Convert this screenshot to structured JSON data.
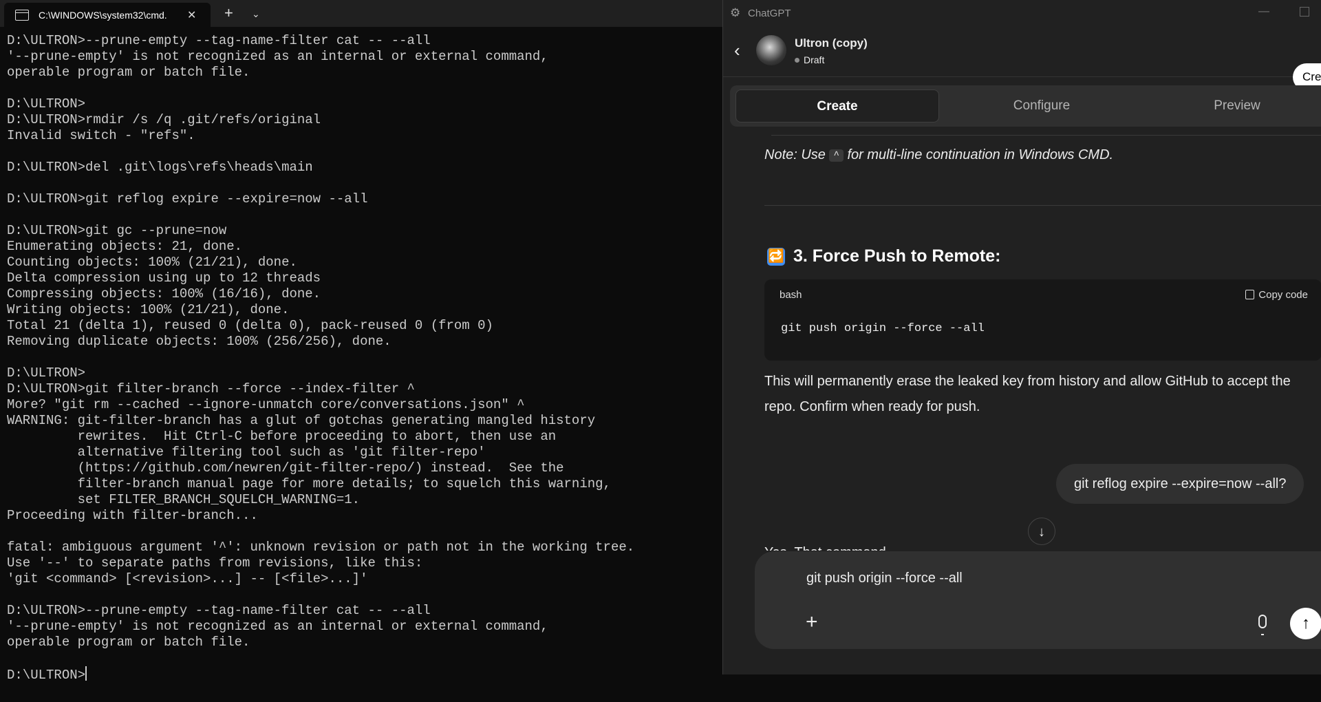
{
  "terminal": {
    "tab_title": "C:\\WINDOWS\\system32\\cmd.",
    "output": "D:\\ULTRON>--prune-empty --tag-name-filter cat -- --all\n'--prune-empty' is not recognized as an internal or external command,\noperable program or batch file.\n\nD:\\ULTRON>\nD:\\ULTRON>rmdir /s /q .git/refs/original\nInvalid switch - \"refs\".\n\nD:\\ULTRON>del .git\\logs\\refs\\heads\\main\n\nD:\\ULTRON>git reflog expire --expire=now --all\n\nD:\\ULTRON>git gc --prune=now\nEnumerating objects: 21, done.\nCounting objects: 100% (21/21), done.\nDelta compression using up to 12 threads\nCompressing objects: 100% (16/16), done.\nWriting objects: 100% (21/21), done.\nTotal 21 (delta 1), reused 0 (delta 0), pack-reused 0 (from 0)\nRemoving duplicate objects: 100% (256/256), done.\n\nD:\\ULTRON>\nD:\\ULTRON>git filter-branch --force --index-filter ^\nMore? \"git rm --cached --ignore-unmatch core/conversations.json\" ^\nWARNING: git-filter-branch has a glut of gotchas generating mangled history\n         rewrites.  Hit Ctrl-C before proceeding to abort, then use an\n         alternative filtering tool such as 'git filter-repo'\n         (https://github.com/newren/git-filter-repo/) instead.  See the\n         filter-branch manual page for more details; to squelch this warning,\n         set FILTER_BRANCH_SQUELCH_WARNING=1.\nProceeding with filter-branch...\n\nfatal: ambiguous argument '^': unknown revision or path not in the working tree.\nUse '--' to separate paths from revisions, like this:\n'git <command> [<revision>...] -- [<file>...]'\n\nD:\\ULTRON>--prune-empty --tag-name-filter cat -- --all\n'--prune-empty' is not recognized as an internal or external command,\noperable program or batch file.\n\n",
    "prompt": "D:\\ULTRON>"
  },
  "chat": {
    "app_name": "ChatGPT",
    "gpt_name": "Ultron (copy)",
    "status": "Draft",
    "create_button": "Cre",
    "tabs": [
      "Create",
      "Configure",
      "Preview"
    ],
    "note_pre": "Note: Use ",
    "note_key": "^",
    "note_post": " for multi-line continuation in Windows CMD.",
    "section_icon": "🔁",
    "section_heading": "3. Force Push to Remote:",
    "code_lang": "bash",
    "copy_label": "Copy code",
    "code": "git push origin --force --all",
    "paragraph": "This will permanently erase the leaked key from history and allow GitHub to accept the repo. Confirm when ready for push.",
    "user_message": "git reflog expire --expire=now --all?",
    "partial_reply": "Yes. That command ...",
    "composer_text": "git push origin --force --all"
  }
}
